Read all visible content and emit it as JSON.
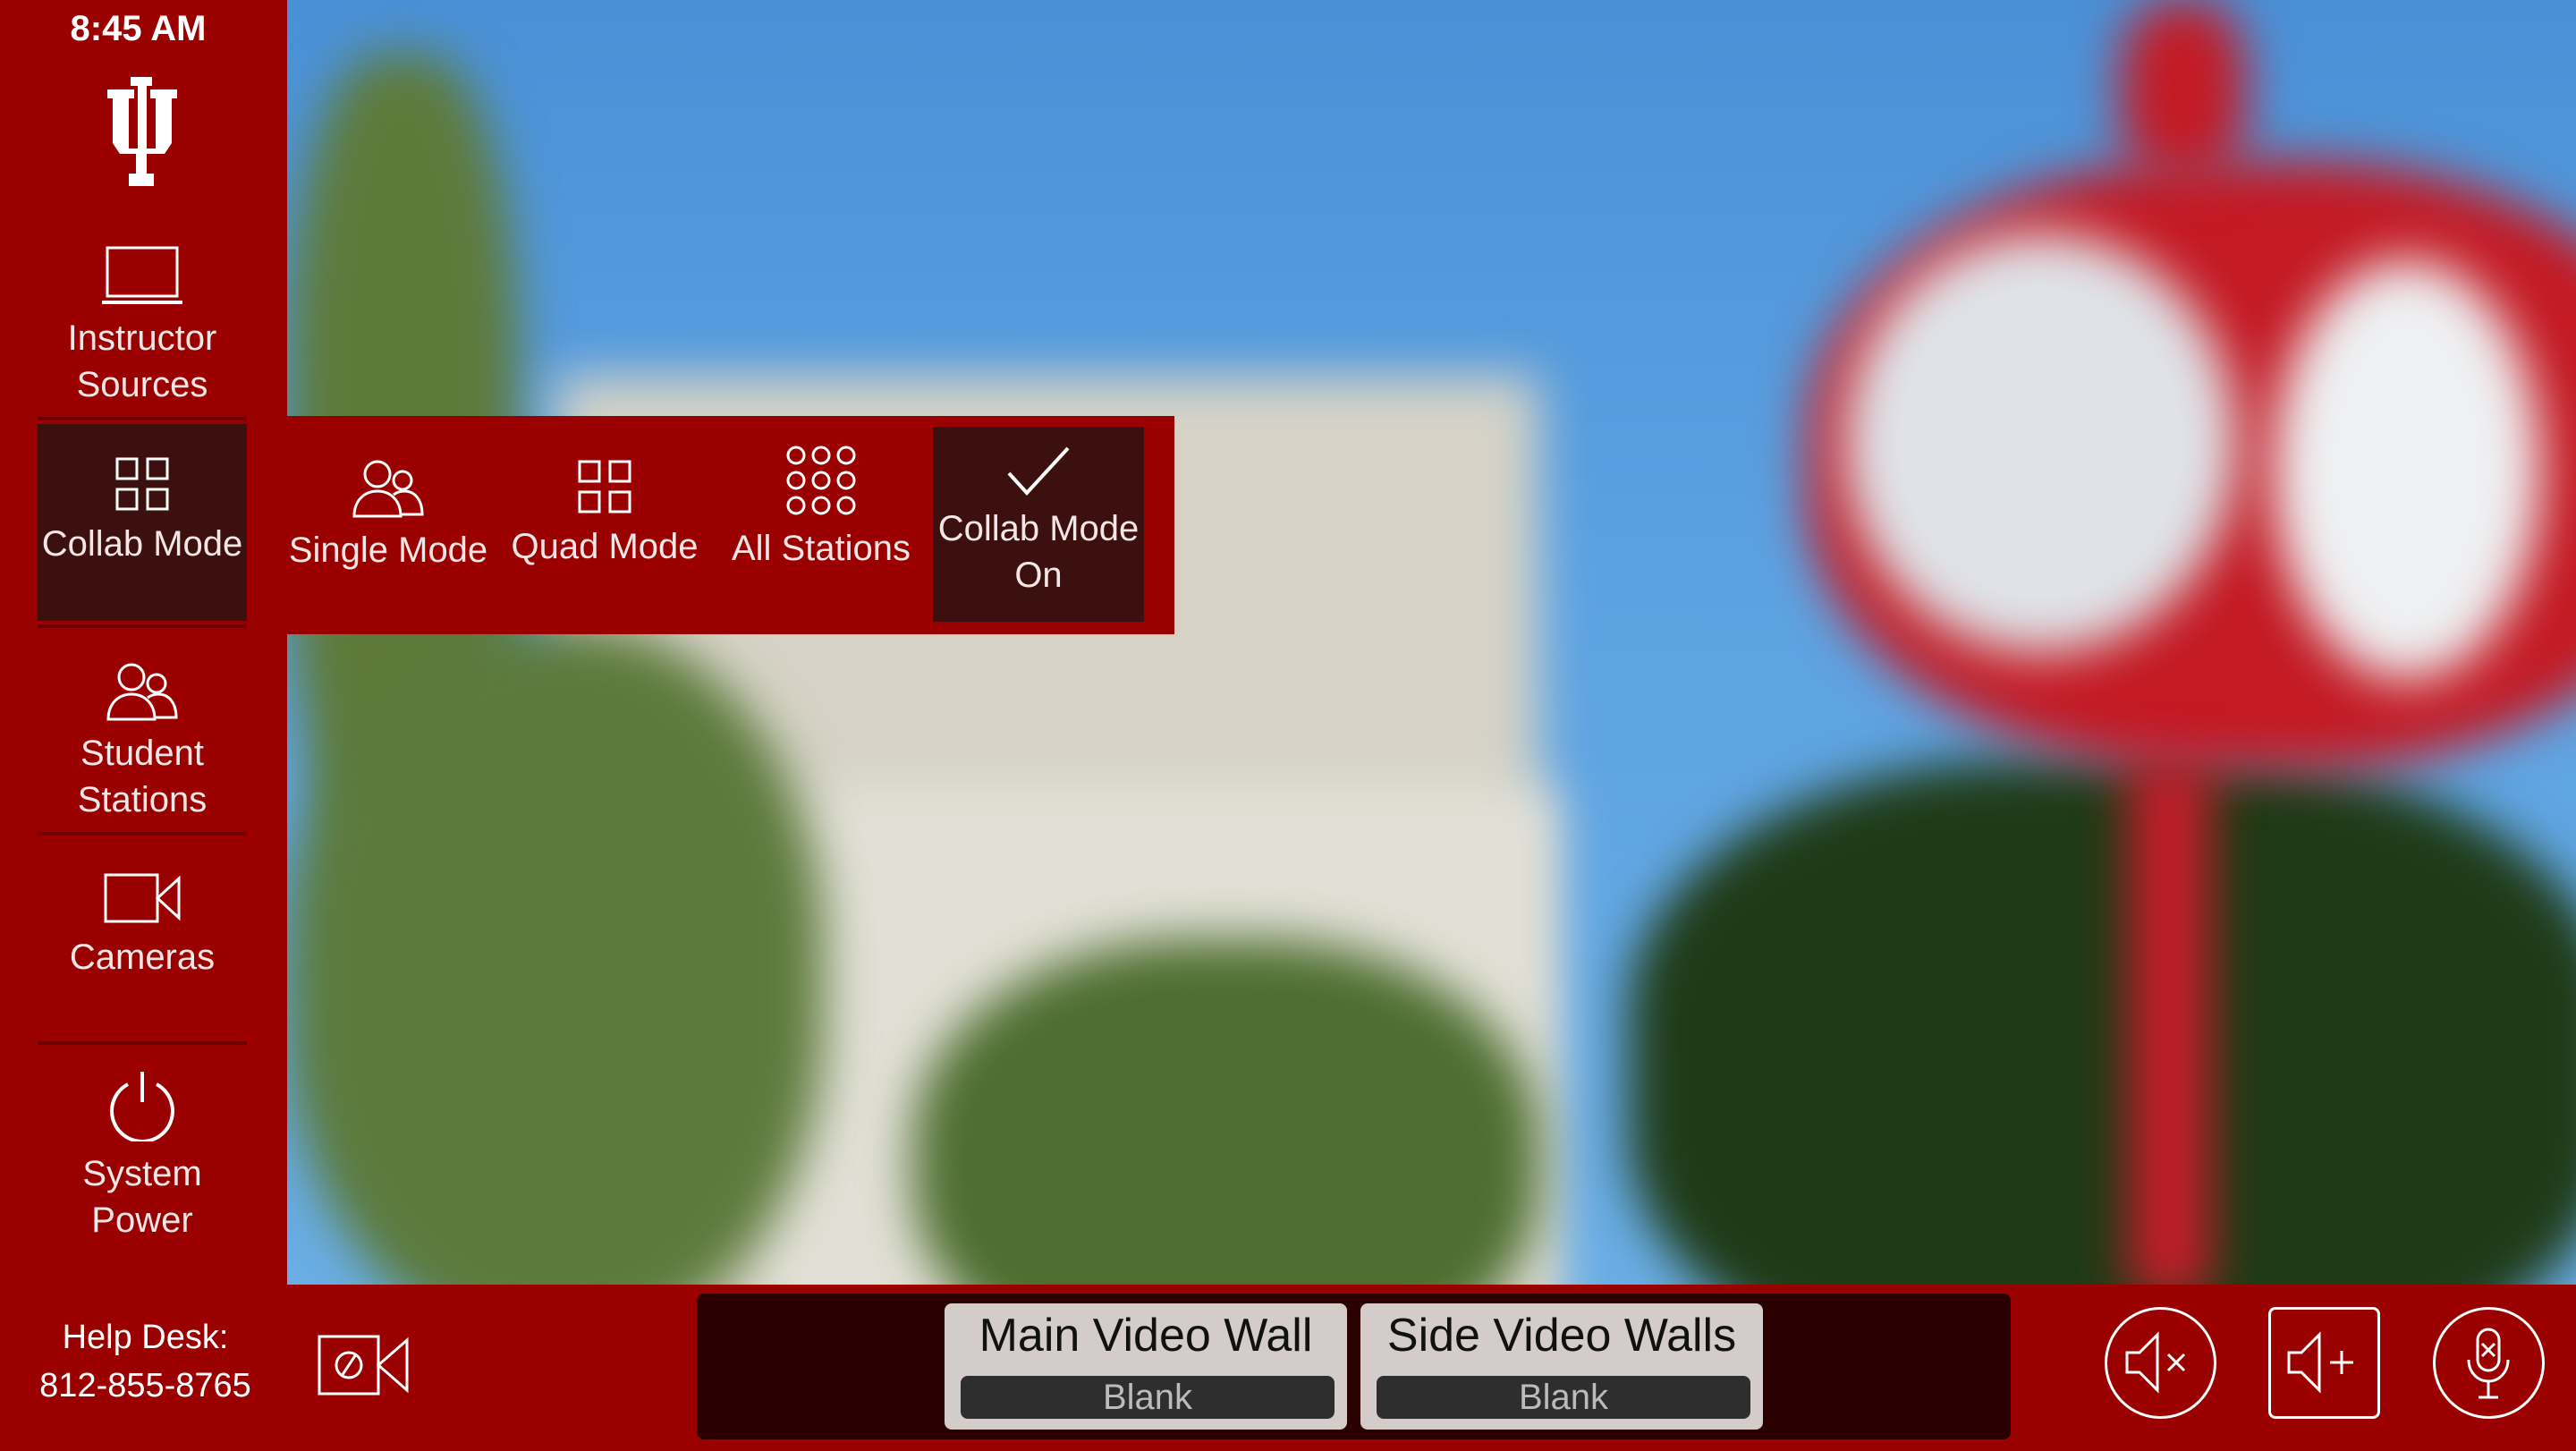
{
  "clock": {
    "time": "8:45 AM"
  },
  "logo": {
    "text": "IU"
  },
  "sidebar": {
    "items": [
      {
        "label": "Instructor Sources",
        "icon": "laptop-icon"
      },
      {
        "label": "Collab Mode",
        "icon": "grid-icon",
        "selected": true
      },
      {
        "label": "Student Stations",
        "icon": "users-icon"
      },
      {
        "label": "Cameras",
        "icon": "video-camera-icon"
      },
      {
        "label": "System Power",
        "icon": "power-icon"
      }
    ]
  },
  "collab_menu": {
    "items": [
      {
        "label": "Single Mode",
        "icon": "users-icon"
      },
      {
        "label": "Quad Mode",
        "icon": "grid-icon"
      },
      {
        "label": "All Stations",
        "icon": "nine-dots-icon"
      },
      {
        "label": "Collab Mode On",
        "icon": "check-icon",
        "selected": true
      }
    ]
  },
  "footer": {
    "help_label": "Help Desk:",
    "help_phone": "812-855-8765",
    "displays": [
      {
        "title": "Main Video Wall",
        "status": "Blank"
      },
      {
        "title": "Side Video Walls",
        "status": "Blank"
      }
    ],
    "controls": [
      "volume-mute-icon",
      "volume-up-icon",
      "mic-mute-icon"
    ]
  },
  "colors": {
    "brand": "#9a0000",
    "selected": "#3d1010",
    "panel": "#2a0000",
    "card": "#d3cccb"
  }
}
